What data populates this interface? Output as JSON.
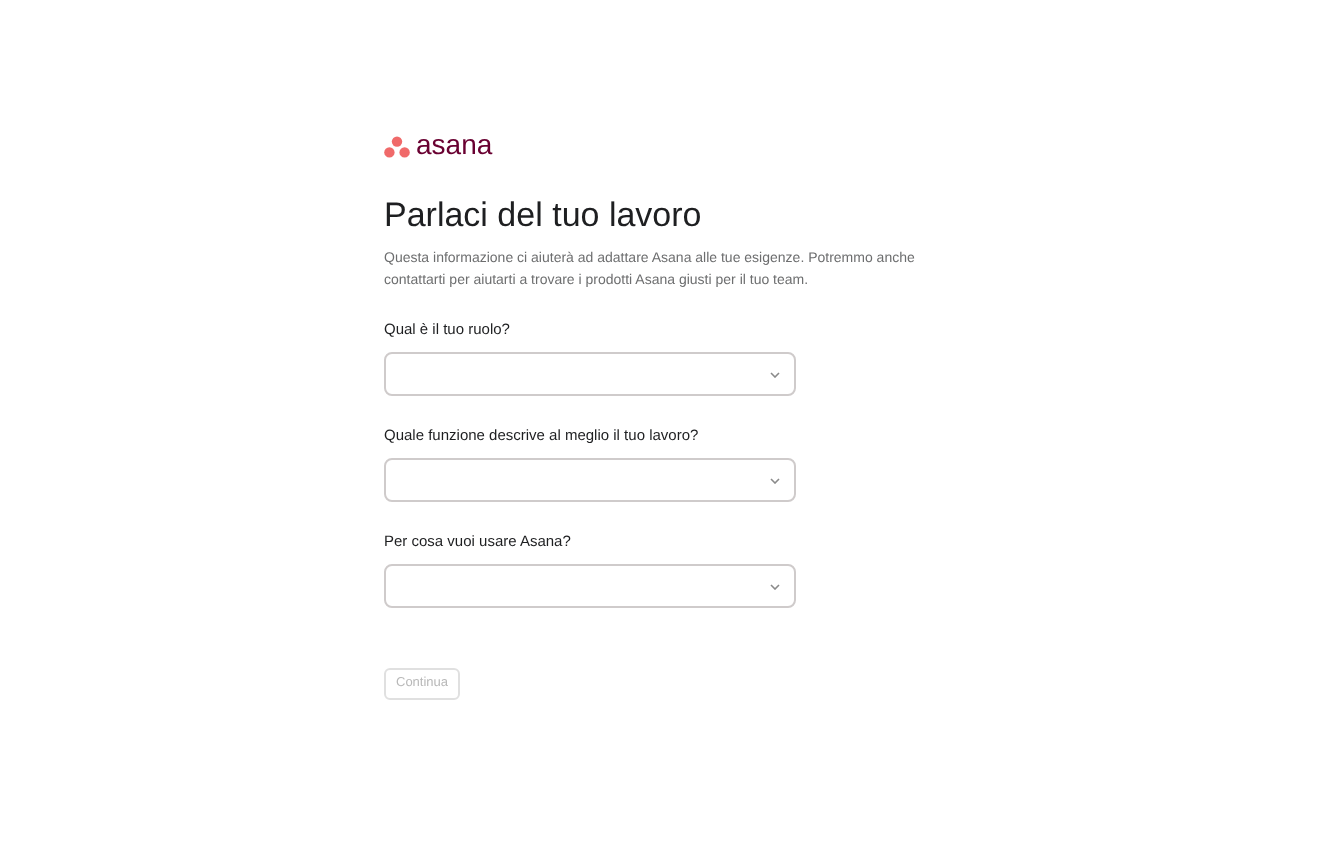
{
  "logo": {
    "text": "asana"
  },
  "title": "Parlaci del tuo lavoro",
  "description": "Questa informazione ci aiuterà ad adattare Asana alle tue esigenze. Potremmo anche contattarti per aiutarti a trovare i prodotti Asana giusti per il tuo team.",
  "fields": [
    {
      "label": "Qual è il tuo ruolo?"
    },
    {
      "label": "Quale funzione descrive al meglio il tuo lavoro?"
    },
    {
      "label": "Per cosa vuoi usare Asana?"
    }
  ],
  "continue_button": {
    "label": "Continua",
    "disabled": true
  }
}
